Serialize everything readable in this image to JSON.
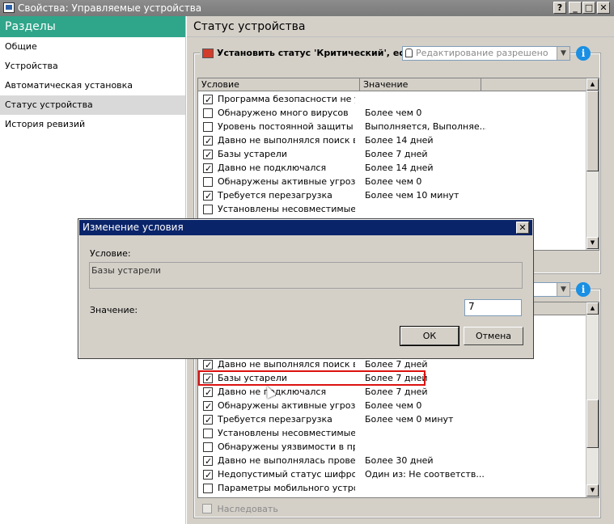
{
  "window": {
    "title": "Свойства: Управляемые устройства",
    "buttons": [
      "?",
      "_",
      "□",
      "✕"
    ]
  },
  "sidebar": {
    "header": "Разделы",
    "items": [
      {
        "label": "Общие",
        "selected": false
      },
      {
        "label": "Устройства",
        "selected": false
      },
      {
        "label": "Автоматическая установка",
        "selected": false
      },
      {
        "label": "Статус устройства",
        "selected": true
      },
      {
        "label": "История ревизий",
        "selected": false
      }
    ]
  },
  "content": {
    "title": "Статус устройства",
    "critical_group": {
      "label": "Установить статус 'Критический', если:",
      "combo_value": "Редактирование разрешено",
      "columns": [
        "Условие",
        "Значение"
      ],
      "rows": [
        {
          "checked": true,
          "condition": "Программа безопасности не уст...",
          "value": ""
        },
        {
          "checked": false,
          "condition": "Обнаружено много вирусов",
          "value": "Более чем 0"
        },
        {
          "checked": false,
          "condition": "Уровень постоянной защиты о...",
          "value": "Выполняется, Выполняе..."
        },
        {
          "checked": true,
          "condition": "Давно не выполнялся поиск вр...",
          "value": "Более 14 дней"
        },
        {
          "checked": true,
          "condition": "Базы устарели",
          "value": "Более 7 дней"
        },
        {
          "checked": true,
          "condition": "Давно не подключался",
          "value": "Более 14 дней"
        },
        {
          "checked": false,
          "condition": "Обнаружены активные угрозы",
          "value": "Более чем 0"
        },
        {
          "checked": true,
          "condition": "Требуется перезагрузка",
          "value": "Более чем 10 минут"
        },
        {
          "checked": false,
          "condition": "Установлены несовместимые п...",
          "value": ""
        }
      ]
    },
    "warning_group": {
      "rows": [
        {
          "checked": true,
          "condition": "Давно не выполнялся поиск вр...",
          "value": "Более 7 дней"
        },
        {
          "checked": true,
          "condition": "Базы устарели",
          "value": "Более 7 дней"
        },
        {
          "checked": true,
          "condition": "Давно не подключался",
          "value": "Более 7 дней"
        },
        {
          "checked": true,
          "condition": "Обнаружены активные угрозы",
          "value": "Более чем 0"
        },
        {
          "checked": true,
          "condition": "Требуется перезагрузка",
          "value": "Более чем 0 минут"
        },
        {
          "checked": false,
          "condition": "Установлены несовместимые п...",
          "value": ""
        },
        {
          "checked": false,
          "condition": "Обнаружены уязвимости в про...",
          "value": ""
        },
        {
          "checked": true,
          "condition": "Давно не выполнялась провер...",
          "value": "Более 30 дней"
        },
        {
          "checked": true,
          "condition": "Недопустимый статус шифрова...",
          "value": "Один из: Не соответств..."
        },
        {
          "checked": false,
          "condition": "Параметры мобильного устрой...",
          "value": ""
        }
      ]
    },
    "inherit_label": "Наследовать"
  },
  "dialog": {
    "title": "Изменение условия",
    "condition_label": "Условие:",
    "condition_text": "Базы устарели",
    "value_label": "Значение:",
    "value": "7",
    "ok": "ОК",
    "cancel": "Отмена"
  },
  "colors": {
    "sidebar_header": "#2fa58a",
    "dialog_title": "#0a246a",
    "highlight": "#dd1111",
    "info": "#1a8fe3"
  }
}
